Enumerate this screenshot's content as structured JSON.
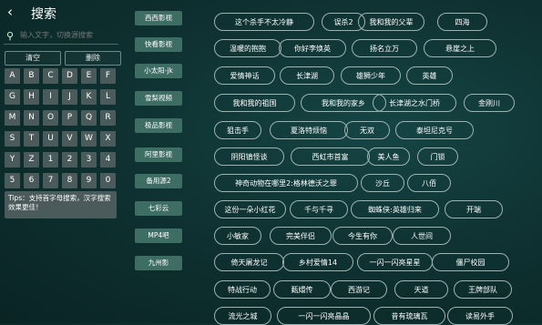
{
  "header": {
    "back_glyph": "‹",
    "title": "搜索"
  },
  "search": {
    "placeholder": "输入文字，切换源搜索",
    "value": ""
  },
  "actions": {
    "clear_label": "清空",
    "delete_label": "删除"
  },
  "keyboard": {
    "keys": [
      "A",
      "B",
      "C",
      "D",
      "E",
      "F",
      "G",
      "H",
      "I",
      "J",
      "K",
      "L",
      "M",
      "N",
      "O",
      "P",
      "Q",
      "R",
      "S",
      "T",
      "U",
      "V",
      "W",
      "X",
      "Y",
      "Z",
      "1",
      "2",
      "3",
      "4",
      "5",
      "6",
      "7",
      "8",
      "9",
      "0"
    ]
  },
  "tips": "Tips：支持首字母搜索，汉字搜索效果更佳！",
  "sources": [
    "西西影视",
    "快看影视",
    "小太阳-jk",
    "雪梨视频",
    "极品影视",
    "阿里影视",
    "备用源2",
    "七彩云",
    "MP4吧",
    "九州影"
  ],
  "results": [
    [
      "这个杀手不太冷静",
      "误杀2",
      "我和我的父辈",
      "四海"
    ],
    [
      "温暖的抱抱",
      "你好李焕英",
      "扬名立万",
      "悬崖之上"
    ],
    [
      "爱情神话",
      "长津湖",
      "雄狮少年",
      "英雄"
    ],
    [
      "我和我的祖国",
      "我和我的家乡",
      "长津湖之水门桥",
      "金刚川"
    ],
    [
      "狙击手",
      "夏洛特烦恼",
      "无双",
      "泰坦尼克号"
    ],
    [
      "阴阳镇怪谈",
      "西虹市首富",
      "美人鱼",
      "门锁"
    ],
    [
      "神奇动物在哪里2:格林德沃之罪",
      "沙丘",
      "八佰"
    ],
    [
      "这份一朵小红花",
      "千与千寻",
      "蜘蛛侠:英雄归来",
      "开端"
    ],
    [
      "小敏家",
      "完美伴侣",
      "今生有你",
      "人世间"
    ],
    [
      "倚天屠龙记",
      "乡村爱情14",
      "一闪一闪亮星星",
      "僵尸校园"
    ],
    [
      "特战行动",
      "甄嬛传",
      "西游记",
      "天道",
      "王牌部队"
    ],
    [
      "流光之城",
      "一闪一闪亮晶晶",
      "昔有琉璃瓦",
      "读易外手"
    ]
  ]
}
